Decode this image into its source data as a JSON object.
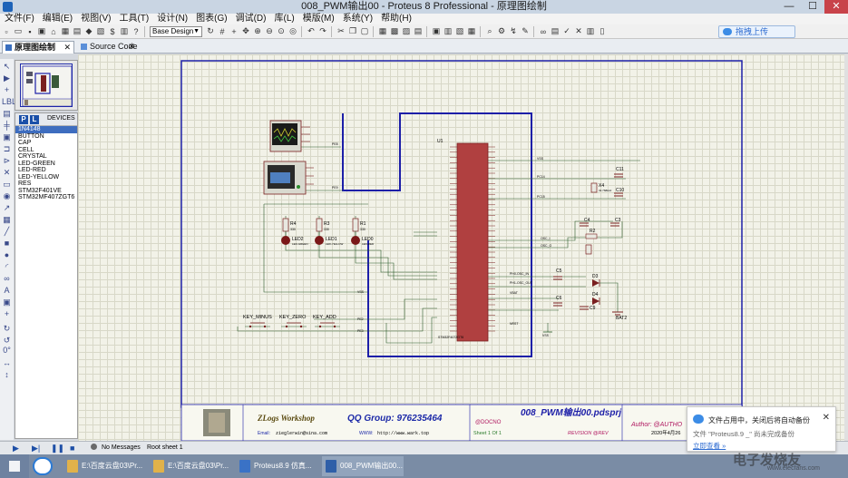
{
  "window": {
    "title": "008_PWM输出00 - Proteus 8 Professional - 原理图绘制",
    "controls": [
      "—",
      "☐",
      "✕"
    ]
  },
  "menu": [
    "文件(F)",
    "编辑(E)",
    "视图(V)",
    "工具(T)",
    "设计(N)",
    "图表(G)",
    "调试(D)",
    "库(L)",
    "模版(M)",
    "系统(Y)",
    "帮助(H)"
  ],
  "toolbar": {
    "design_select": "Base Design",
    "cloud_button": "拖拽上传"
  },
  "tabs": [
    {
      "label": "原理图绘制",
      "active": true
    },
    {
      "label": "Source Code",
      "active": false
    }
  ],
  "device_panel": {
    "p_button": "P",
    "l_button": "L",
    "title": "DEVICES",
    "items": [
      "1N4148",
      "BUTTON",
      "CAP",
      "CELL",
      "CRYSTAL",
      "LED-GREEN",
      "LED-RED",
      "LED-YELLOW",
      "RES",
      "STM32F401VE",
      "STM32MF407ZGT6"
    ],
    "selected_index": 0
  },
  "left_tools": {
    "rotation": "0°"
  },
  "schematic": {
    "mcu_label": "U1",
    "mcu_part": "STM32F407ZGT6",
    "crystal_label": "X4",
    "crystal_value": "32.768kHz",
    "parts": [
      "C11",
      "C10",
      "C4",
      "C3",
      "R2",
      "R3",
      "R4",
      "R1",
      "C5",
      "C6",
      "C9",
      "D3",
      "D4",
      "BAT2"
    ],
    "leds": [
      {
        "ref": "LED2",
        "part": "LED-GREEN"
      },
      {
        "ref": "LED1",
        "part": "LED-YELLOW"
      },
      {
        "ref": "LED0",
        "part": "LED-RED"
      }
    ],
    "buttons": [
      "KEY_MINUS",
      "KEY_ZERO",
      "KEY_ADD"
    ],
    "nets": [
      "VSS",
      "VDD",
      "PC13",
      "PC14",
      "PC15",
      "PE2",
      "PE3",
      "PE4",
      "PA0",
      "OSC_I",
      "OSC_O",
      "PE8",
      "PE9"
    ],
    "res_values": [
      "330",
      "330",
      "330"
    ],
    "cap_values": [
      "22pF",
      "22pF",
      "20pF",
      "20pF",
      "100nF",
      "100nF",
      "100nF"
    ],
    "resistor_values_2": [
      "10k",
      "1M"
    ],
    "mcu_bottom_pins": [
      "PH0-OSC_IN",
      "PH1-OSC_OUT",
      "VBAT",
      "NRST"
    ]
  },
  "title_block": {
    "brand": "ZLogs Workshop",
    "qq": "QQ Group: 976235464",
    "email_label": "Email:",
    "email": "zieglerwin@sina.com",
    "www_label": "WWW:",
    "www": "http://www.wark.top",
    "doc_no": "@DOCNO",
    "project": "008_PWM输出00.pdsprj",
    "sheet": "Sheet 1 Of 1",
    "revision": "REVISION @REV",
    "author": "Author: @AUTHO",
    "date": "2020年4月26"
  },
  "status": {
    "messages": "No Messages",
    "sheet": "Root sheet 1"
  },
  "taskbar": {
    "apps": [
      {
        "label": "E:\\百度云盘03\\Pr..."
      },
      {
        "label": "E:\\百度云盘03\\Pr..."
      },
      {
        "label": "Proteus8.9 仿真..."
      },
      {
        "label": "008_PWM输出00..."
      }
    ]
  },
  "notification": {
    "title": "文件占用中，关闭后将自动备份",
    "body": "文件 \"Proteus8.9 _\" 尚未完成备份",
    "link": "立即查看 »",
    "close": "✕"
  },
  "watermark": {
    "main": "电子发烧友",
    "sub": "www.elecfans.com"
  },
  "colors": {
    "frame": "#1d1fa8",
    "wire": "#2a5a2a",
    "part": "#7a2020",
    "led": "#7a1818",
    "canvas_bg": "#f2f2e8",
    "titlebar_bg": "#c9d5e3"
  }
}
